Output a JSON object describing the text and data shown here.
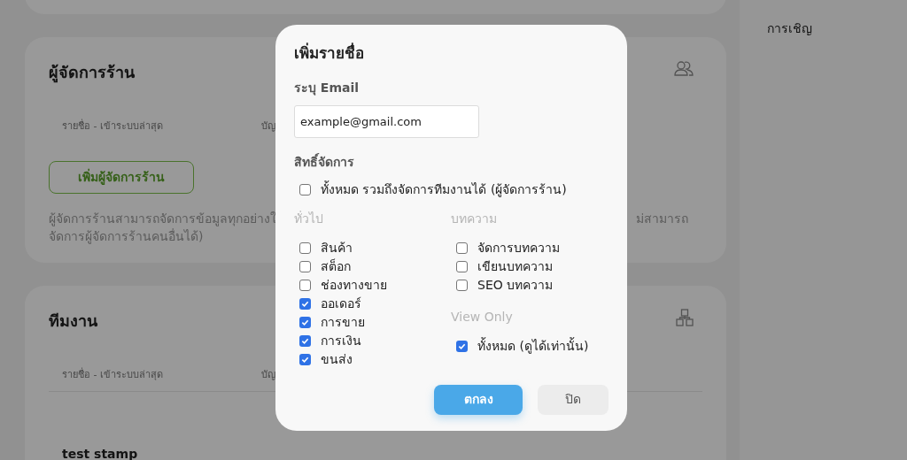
{
  "side_panel": {
    "title": "การเชิญ"
  },
  "sections": [
    {
      "kind": "managers",
      "title": "ผู้จัดการร้าน",
      "columns": [
        "รายชื่อ - เข้าระบบล่าสุด",
        "บัญ"
      ],
      "button": "เพิ่มผู้จัดการร้าน",
      "description_left": [
        "ผู้จัดการร้านสามารถจัดการข้อมูลทุกอย่างใ",
        "จัดการผู้จัดการร้านคนอื่นได้)"
      ],
      "description_right": "ม่สามารถ"
    },
    {
      "kind": "team",
      "title": "ทีมงาน",
      "columns": [
        "รายชื่อ - เข้าระบบล่าสุด",
        "บัญ"
      ],
      "rows": [
        {
          "name": "test stamp"
        }
      ]
    }
  ],
  "dialog": {
    "title": "เพิ่มรายชื่อ",
    "email_label": "ระบุ Email",
    "email_value": "example@gmail.com",
    "permissions_label": "สิทธิ์จัดการ",
    "all_option": {
      "label": "ทั้งหมด รวมถึงจัดการทีมงานได้ (ผู้จัดการร้าน)",
      "checked": false
    },
    "groups": [
      {
        "title": "ทั่วไป",
        "items": [
          {
            "label": "สินค้า",
            "checked": false
          },
          {
            "label": "สต็อก",
            "checked": false
          },
          {
            "label": "ช่องทางขาย",
            "checked": false
          },
          {
            "label": "ออเดอร์",
            "checked": true
          },
          {
            "label": "การขาย",
            "checked": true
          },
          {
            "label": "การเงิน",
            "checked": true
          },
          {
            "label": "ขนส่ง",
            "checked": true
          }
        ]
      },
      {
        "title": "บทความ",
        "items": [
          {
            "label": "จัดการบทความ",
            "checked": false
          },
          {
            "label": "เขียนบทความ",
            "checked": false
          },
          {
            "label": "SEO บทความ",
            "checked": false
          }
        ]
      },
      {
        "title": "View Only",
        "items": [
          {
            "label": "ทั้งหมด (ดูได้เท่านั้น)",
            "checked": true
          }
        ]
      }
    ],
    "buttons": [
      {
        "label": "ตกลง",
        "kind": "primary"
      },
      {
        "label": "ปิด",
        "kind": "secondary"
      }
    ]
  }
}
